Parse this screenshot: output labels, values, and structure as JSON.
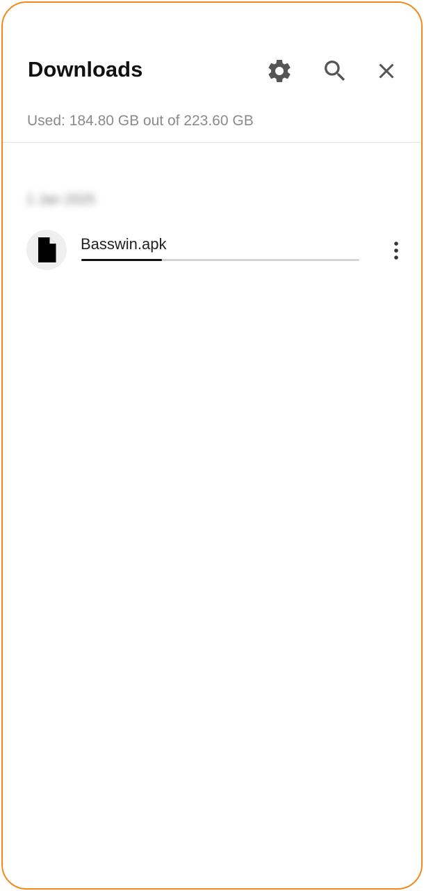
{
  "header": {
    "title": "Downloads",
    "icons": {
      "settings": "gear-icon",
      "search": "search-icon",
      "close": "close-icon"
    }
  },
  "storage": {
    "text": "Used: 184.80 GB out of 223.60 GB"
  },
  "sections": [
    {
      "date_label": "1 Jan 2025",
      "items": [
        {
          "name": "Basswin.apk",
          "icon": "file-icon",
          "progress": 0.29,
          "more_icon": "more-vertical-icon"
        }
      ]
    }
  ],
  "colors": {
    "frame_border": "#f28a1a",
    "progress_fill": "#111111",
    "progress_track": "#d4d4d4",
    "icon_gray": "#555555"
  }
}
